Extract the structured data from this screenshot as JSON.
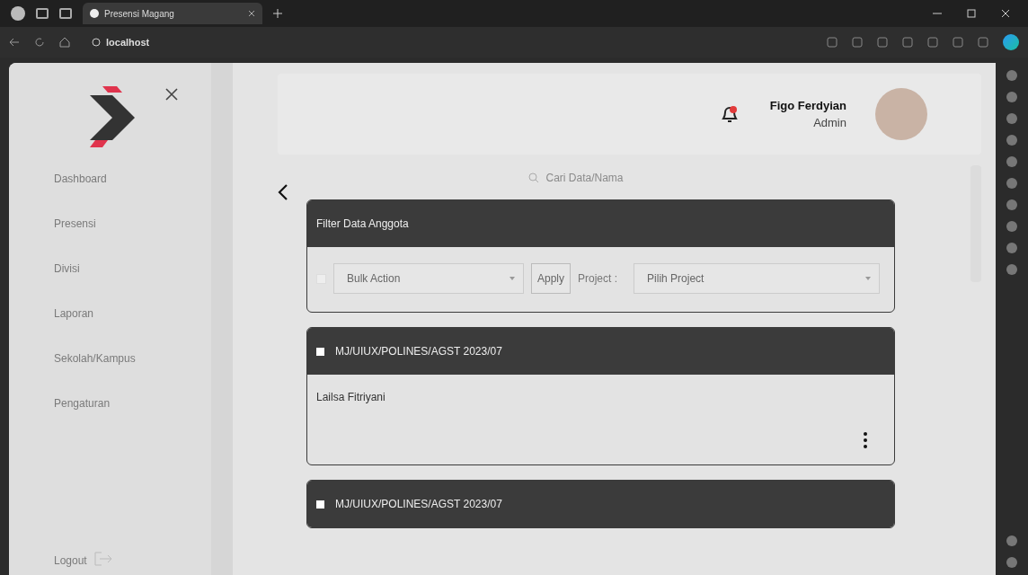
{
  "browser": {
    "tab_title": "Presensi Magang",
    "url": "localhost"
  },
  "sidebar": {
    "items": [
      {
        "label": "Dashboard",
        "selected": false
      },
      {
        "label": "Presensi",
        "selected": false
      },
      {
        "label": "Divisi",
        "selected": false
      },
      {
        "label": "Laporan",
        "selected": false
      },
      {
        "label": "Sekolah/Kampus",
        "selected": false
      },
      {
        "label": "Pengaturan",
        "selected": false
      }
    ],
    "logout": "Logout"
  },
  "header": {
    "user_name": "Figo Ferdyian",
    "user_role": "Admin"
  },
  "search": {
    "placeholder": "Cari Data/Nama"
  },
  "filter": {
    "checked": false,
    "title": "Filter Data Anggota",
    "bulk_action": "Bulk Action",
    "apply": "Apply",
    "project_label": "Project :",
    "project_select": "Pilih Project"
  },
  "members": [
    {
      "checked": false,
      "code": "MJ/UIUX/POLINES/AGST 2023/07",
      "name": "Lailsa Fitriyani"
    },
    {
      "checked": false,
      "code": "MJ/UIUX/POLINES/AGST 2023/07"
    }
  ]
}
